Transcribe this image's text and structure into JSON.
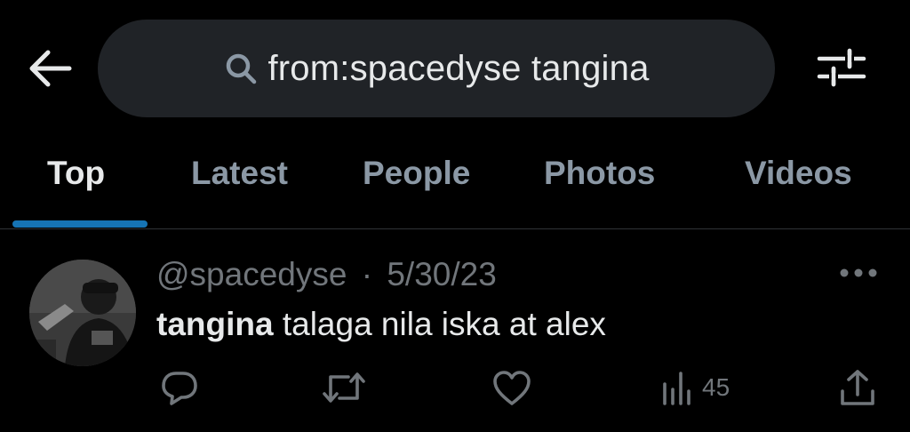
{
  "search": {
    "query": "from:spacedyse tangina"
  },
  "tabs": [
    {
      "label": "Top",
      "active": true
    },
    {
      "label": "Latest",
      "active": false
    },
    {
      "label": "People",
      "active": false
    },
    {
      "label": "Photos",
      "active": false
    },
    {
      "label": "Videos",
      "active": false
    }
  ],
  "tweet": {
    "handle": "@spacedyse",
    "separator": "·",
    "date": "5/30/23",
    "highlight": "tangina",
    "text_rest": " talaga nila iska at alex",
    "views": "45"
  },
  "icons": {
    "back": "back-arrow-icon",
    "search": "search-icon",
    "filter": "filter-sliders-icon",
    "more": "more-dots-icon",
    "reply": "reply-icon",
    "retweet": "retweet-icon",
    "like": "heart-icon",
    "views": "views-chart-icon",
    "share": "share-icon"
  },
  "colors": {
    "background": "#000000",
    "search_pill": "#202327",
    "accent": "#1d9bf0",
    "muted": "#71767b",
    "tab_inactive": "#8b98a5",
    "text": "#e7e9ea"
  }
}
